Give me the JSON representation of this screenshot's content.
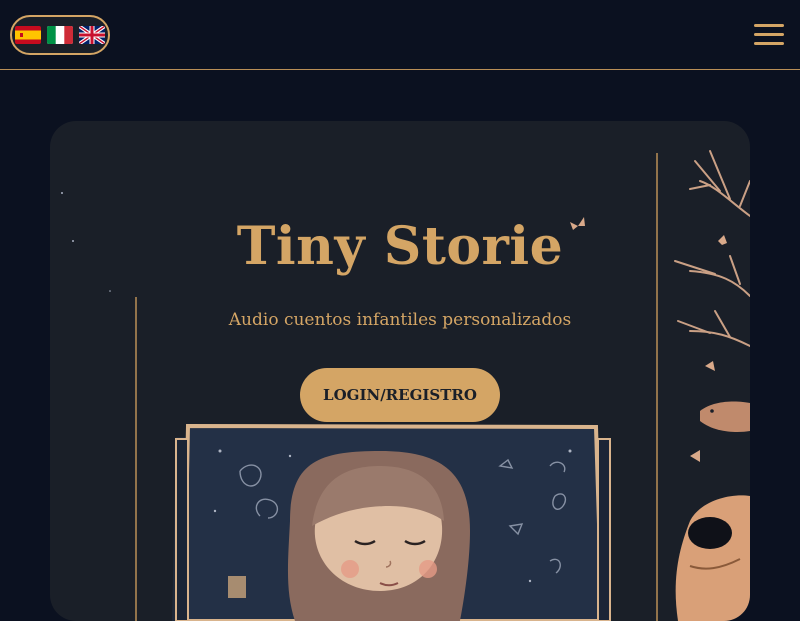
{
  "header": {
    "languages": [
      {
        "code": "es",
        "label": "Español"
      },
      {
        "code": "it",
        "label": "Italiano"
      },
      {
        "code": "en",
        "label": "English"
      }
    ],
    "menu_icon": "hamburger-menu-icon"
  },
  "hero": {
    "title": "Tiny Storie",
    "subtitle": "Audio cuentos infantiles personalizados",
    "login_label": "LOGIN/REGISTRO",
    "illustration": "girl-in-storybook-illustration",
    "side_illustration": "bear-and-branches-illustration"
  },
  "colors": {
    "page_bg": "#0b1120",
    "card_bg": "#1a1f28",
    "accent": "#d4a565",
    "button_text": "#1a1f28"
  }
}
